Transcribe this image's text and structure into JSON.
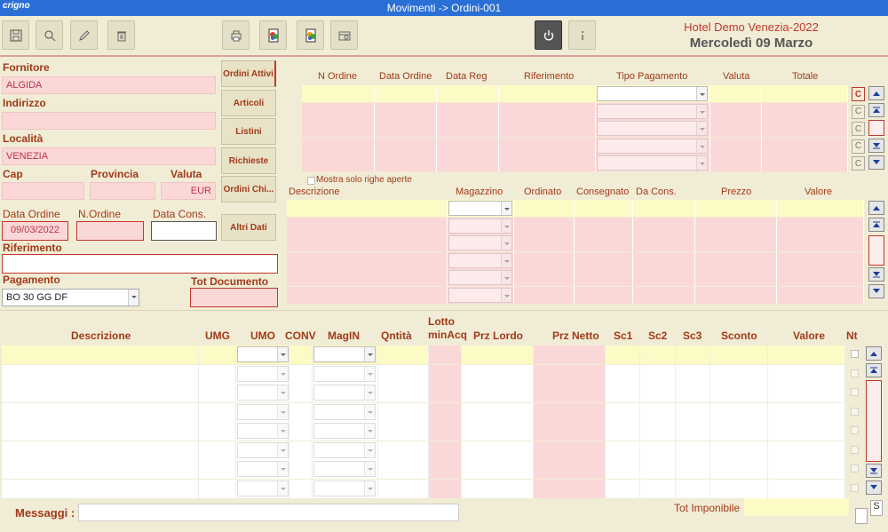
{
  "app": {
    "logo": "crigno",
    "title": "Movimenti -> Ordini-001"
  },
  "header": {
    "hotel_name": "Hotel Demo Venezia-2022",
    "date": "Mercoledì 09 Marzo"
  },
  "supplier": {
    "fornitore_label": "Fornitore",
    "fornitore_value": "ALGIDA",
    "indirizzo_label": "Indirizzo",
    "indirizzo_value": "",
    "localita_label": "Località",
    "localita_value": "VENEZIA",
    "cap_label": "Cap",
    "cap_value": "",
    "provincia_label": "Provincia",
    "provincia_value": "",
    "valuta_label": "Valuta",
    "valuta_value": "EUR"
  },
  "side_buttons": {
    "ordini_attivi": "Ordini Attivi",
    "articoli": "Articoli",
    "listini": "Listini",
    "richieste": "Richieste",
    "ordini_chi": "Ordini Chi...",
    "altri_dati": "Altri Dati"
  },
  "order": {
    "data_ordine_label": "Data Ordine",
    "data_ordine_value": "09/03/2022",
    "n_ordine_label": "N.Ordine",
    "n_ordine_value": "",
    "data_cons_label": "Data Cons.",
    "data_cons_value": "",
    "riferimento_label": "Riferimento",
    "riferimento_value": "",
    "pagamento_label": "Pagamento",
    "pagamento_value": "BO 30 GG DF",
    "tot_documento_label": "Tot Documento",
    "tot_documento_value": ""
  },
  "orders_grid": {
    "headers": [
      "N Ordine",
      "Data Ordine",
      "Data Reg",
      "Riferimento",
      "Tipo Pagamento",
      "Valuta",
      "Totale"
    ],
    "c_label": "C"
  },
  "detail_grid": {
    "mostra_label": "Mostra solo righe aperte",
    "headers": [
      "Descrizione",
      "Magazzino",
      "Ordinato",
      "Consegnato",
      "Da Cons.",
      "Prezzo",
      "Valore"
    ]
  },
  "lines_grid": {
    "headers": [
      "Descrizione",
      "UMG",
      "UMO",
      "CONV",
      "MagIN",
      "Qntità",
      "Lotto minAcq",
      "Prz Lordo",
      "Prz Netto",
      "Sc1",
      "Sc2",
      "Sc3",
      "Sconto",
      "Valore",
      "Nt"
    ]
  },
  "footer": {
    "messaggi_label": "Messaggi :",
    "messaggi_value": "",
    "tot_imponibile_label": "Tot Imponibile",
    "tot_imponibile_value": "",
    "s_label": "S"
  }
}
